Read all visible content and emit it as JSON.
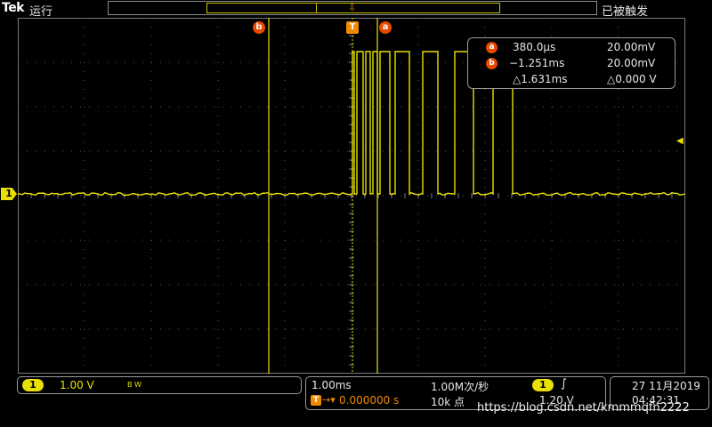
{
  "header": {
    "brand": "Tek",
    "run_state": "运行",
    "trigger_state": "已被触发"
  },
  "markers": {
    "ch1": "1",
    "cursor_b": "b",
    "cursor_a": "a",
    "trigger": "T"
  },
  "cursor_readout": {
    "a": {
      "tag": "a",
      "time": "380.0μs",
      "volts": "20.00mV"
    },
    "b": {
      "tag": "b",
      "time": "−1.251ms",
      "volts": "20.00mV"
    },
    "delta": {
      "time": "△1.631ms",
      "volts": "△0.000 V"
    }
  },
  "channel": {
    "number": "1",
    "scale": "1.00 V",
    "bw_label": "B W"
  },
  "horizontal": {
    "scale": "1.00ms",
    "sample_rate": "1.00M次/秒",
    "position": "0.000000 s",
    "record_length": "10k 点"
  },
  "trigger": {
    "source": "1",
    "slope_symbol": "∫",
    "level": "1.20 V"
  },
  "datetime": {
    "date": "27 11月2019",
    "time": "04:42:31"
  },
  "watermark": "https://blog.csdn.net/kmmmqfn2222",
  "colors": {
    "trace": "#e8e000",
    "cursor_tag": "#e64a00",
    "trigger_marker": "#f08a00",
    "background": "#000000",
    "grid": "#5a5a5a"
  }
}
